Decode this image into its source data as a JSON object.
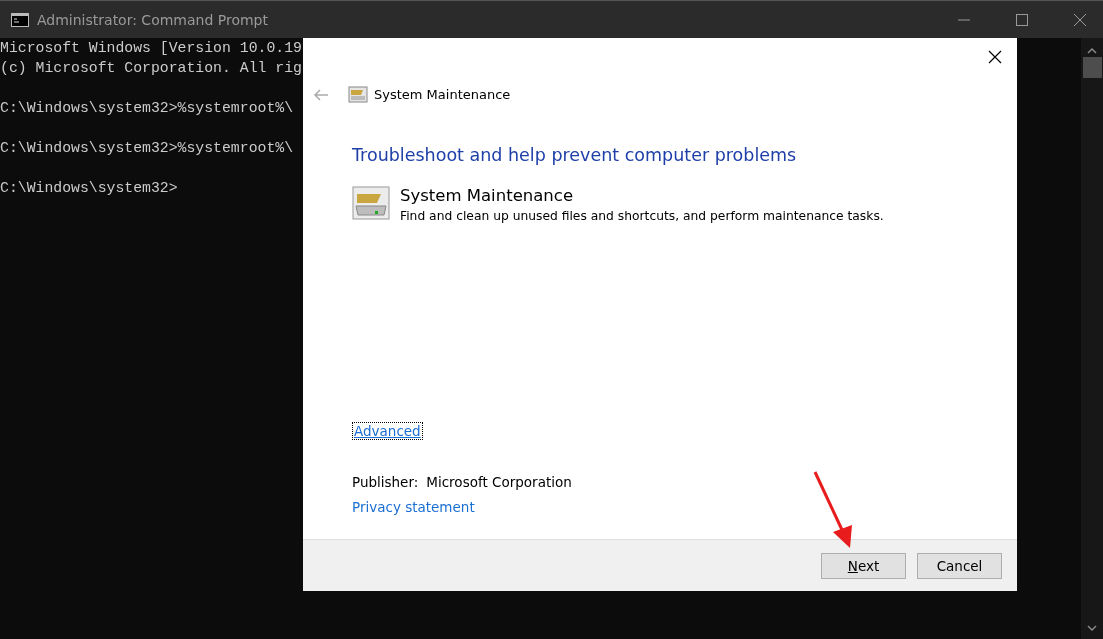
{
  "window": {
    "title": "Administrator: Command Prompt"
  },
  "console": {
    "paragraphs": [
      [
        "Microsoft Windows [Version 10.0.19",
        "(c) Microsoft Corporation. All rig"
      ],
      [
        "C:\\Windows\\system32>%systemroot%\\"
      ],
      [
        "C:\\Windows\\system32>%systemroot%\\"
      ],
      [
        "C:\\Windows\\system32>"
      ]
    ]
  },
  "dialog": {
    "breadcrumb": "System Maintenance",
    "heading": "Troubleshoot and help prevent computer problems",
    "item": {
      "title": "System Maintenance",
      "description": "Find and clean up unused files and shortcuts, and perform maintenance tasks."
    },
    "advanced_link": {
      "label": "Advanced",
      "focused": true
    },
    "publisher_label": "Publisher:",
    "publisher": "Microsoft Corporation",
    "privacy_link": "Privacy statement",
    "buttons": [
      {
        "label": "Next",
        "mnemonic": true
      },
      {
        "label": "Cancel",
        "mnemonic": false
      }
    ]
  }
}
